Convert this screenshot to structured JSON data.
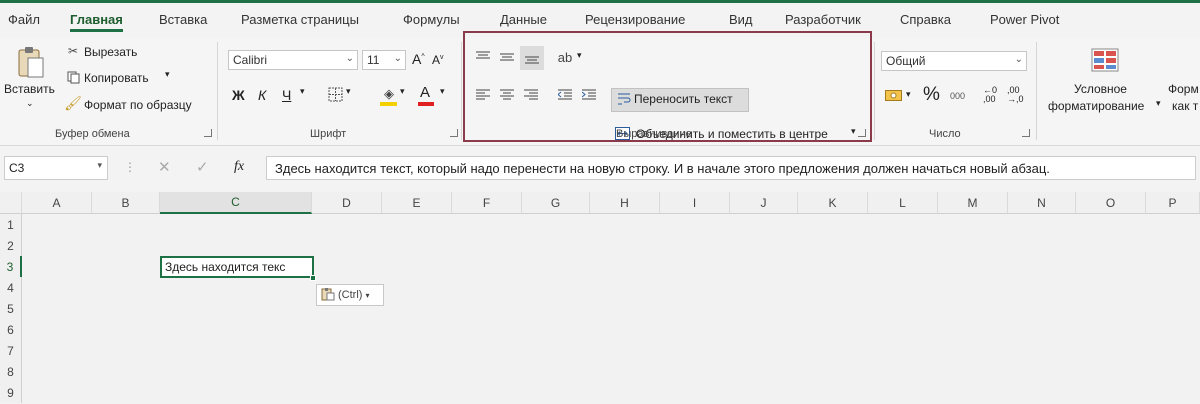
{
  "tabs": [
    "Файл",
    "Главная",
    "Вставка",
    "Разметка страницы",
    "Формулы",
    "Данные",
    "Рецензирование",
    "Вид",
    "Разработчик",
    "Справка",
    "Power Pivot"
  ],
  "clipboard": {
    "paste_label": "Вставить",
    "cut_label": "Вырезать",
    "copy_label": "Копировать",
    "format_painter_label": "Формат по образцу",
    "group_label": "Буфер обмена"
  },
  "font": {
    "font_name": "Calibri",
    "font_size": "11",
    "bold": "Ж",
    "italic": "К",
    "underline": "Ч",
    "group_label": "Шрифт"
  },
  "alignment": {
    "wrap_text_label": "Переносить текст",
    "merge_label": "Объединить и поместить в центре",
    "group_label": "Выравнивание"
  },
  "number": {
    "format": "Общий",
    "group_label": "Число"
  },
  "styles": {
    "conditional_line1": "Условное",
    "conditional_line2": "форматирование",
    "format_table_line1": "Форм",
    "format_table_line2": "как т"
  },
  "formula_bar": {
    "name_box": "C3",
    "fx": "fx",
    "formula": "Здесь находится текст, который надо перенести на новую строку. И в начале этого предложения должен начаться новый абзац."
  },
  "columns": [
    "A",
    "B",
    "C",
    "D",
    "E",
    "F",
    "G",
    "H",
    "I",
    "J",
    "K",
    "L",
    "M",
    "N",
    "O",
    "P"
  ],
  "rows": [
    "1",
    "2",
    "3",
    "4",
    "5",
    "6",
    "7",
    "8",
    "9"
  ],
  "active_cell": {
    "display": "Здесь находится текс"
  },
  "paste_options": {
    "label": "(Ctrl)"
  },
  "colors": {
    "accent": "#1e7145",
    "highlight_border": "#8b3a4a",
    "font_color": "#e02020",
    "fill_color": "#f5d000"
  }
}
